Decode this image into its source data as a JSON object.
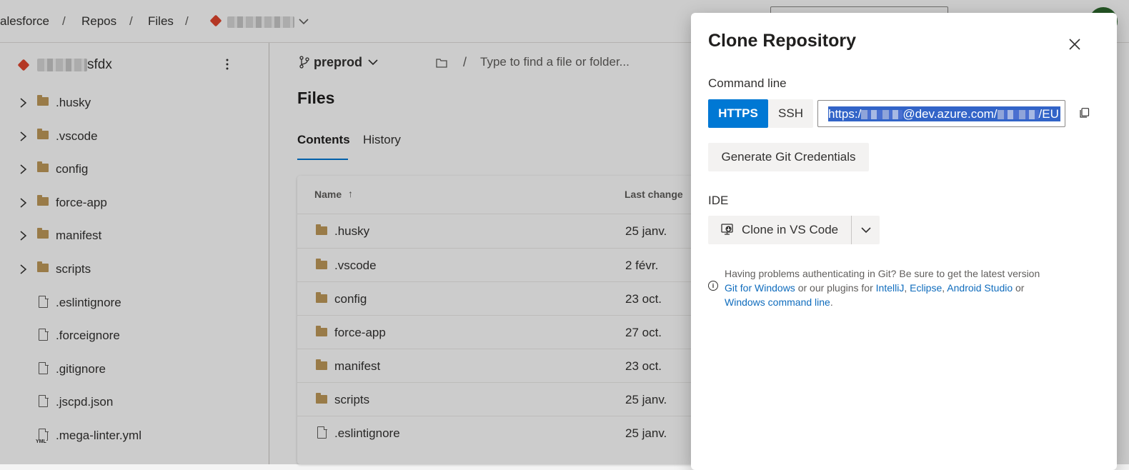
{
  "breadcrumb": {
    "org": "alesforce",
    "repos": "Repos",
    "files": "Files",
    "separator": "/"
  },
  "sidebar": {
    "repo_suffix": "sfdx",
    "items": [
      {
        "label": ".husky",
        "type": "folder"
      },
      {
        "label": ".vscode",
        "type": "folder"
      },
      {
        "label": "config",
        "type": "folder"
      },
      {
        "label": "force-app",
        "type": "folder"
      },
      {
        "label": "manifest",
        "type": "folder"
      },
      {
        "label": "scripts",
        "type": "folder"
      },
      {
        "label": ".eslintignore",
        "type": "file"
      },
      {
        "label": ".forceignore",
        "type": "file"
      },
      {
        "label": ".gitignore",
        "type": "file"
      },
      {
        "label": ".jscpd.json",
        "type": "file"
      },
      {
        "label": ".mega-linter.yml",
        "type": "yml"
      }
    ],
    "yml_badge": "YML"
  },
  "main": {
    "branch": "preprod",
    "path_placeholder": "Type to find a file or folder...",
    "title": "Files",
    "tabs": [
      "Contents",
      "History"
    ],
    "table": {
      "headers": {
        "name": "Name",
        "sort_arrow": "↑",
        "last_change": "Last change"
      },
      "rows": [
        {
          "name": ".husky",
          "date": "25 janv.",
          "type": "folder"
        },
        {
          "name": ".vscode",
          "date": "2 févr.",
          "type": "folder"
        },
        {
          "name": "config",
          "date": "23 oct.",
          "type": "folder"
        },
        {
          "name": "force-app",
          "date": "27 oct.",
          "type": "folder"
        },
        {
          "name": "manifest",
          "date": "23 oct.",
          "type": "folder"
        },
        {
          "name": "scripts",
          "date": "25 janv.",
          "type": "folder"
        },
        {
          "name": ".eslintignore",
          "date": "25 janv.",
          "type": "file"
        }
      ]
    }
  },
  "dialog": {
    "title": "Clone Repository",
    "command_line_label": "Command line",
    "https_label": "HTTPS",
    "ssh_label": "SSH",
    "url_prefix": "https:/",
    "url_middle": "@dev.azure.com/",
    "url_suffix": "/EU",
    "generate_label": "Generate Git Credentials",
    "ide_label": "IDE",
    "clone_vs_label": "Clone in VS Code",
    "help": {
      "text1": "Having problems authenticating in Git? Be sure to get the latest version",
      "link_git_windows": "Git for Windows",
      "text2": " or our plugins for ",
      "link_intellij": "IntelliJ",
      "comma": ", ",
      "link_eclipse": "Eclipse",
      "comma2": ", ",
      "link_android": "Android Studio",
      "text3": " or",
      "link_cmd": "Windows command line",
      "period": "."
    },
    "info_icon": "i"
  },
  "colors": {
    "accent": "#0078d4",
    "folder": "#c09a5b",
    "git": "#e2452d",
    "link": "#0f6cbd"
  }
}
